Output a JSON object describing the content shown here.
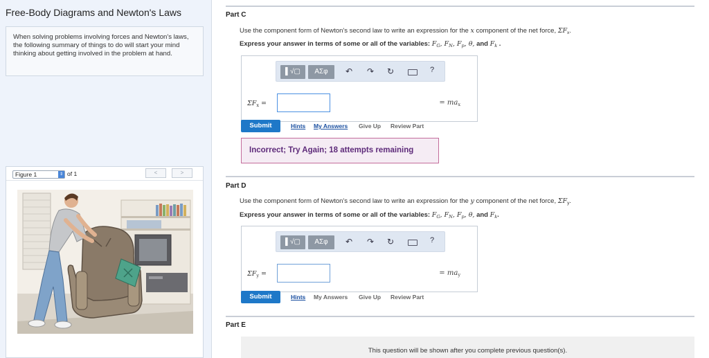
{
  "left": {
    "title": "Free-Body Diagrams and Newton's Laws",
    "intro": "When solving problems involving forces and Newton's laws, the following summary of things to do will start your mind thinking about getting involved in the problem at hand.",
    "figure": {
      "selected": "Figure 1",
      "of_label": "of 1",
      "prev": "<",
      "next": ">"
    }
  },
  "partC": {
    "label": "Part C",
    "question_pre": "Use the component form of Newton's second law to write an expression for the",
    "question_var": "x",
    "question_post": "component of the net force,",
    "sum_symbol": "ΣF",
    "sum_sub": "x",
    "instruction": "Express your answer in terms of some or all of the variables:",
    "variables": "F_G, F_N, F_p, θ, and F_k",
    "lhs": "ΣF",
    "lhs_sub": "x",
    "equals": "=",
    "rhs": "= ma",
    "rhs_sub": "x",
    "input_value": "",
    "feedback": "Incorrect; Try Again; 18 attempts remaining"
  },
  "partD": {
    "label": "Part D",
    "question_pre": "Use the component form of Newton's second law to write an expression for the",
    "question_var": "y",
    "question_post": "component of the net force,",
    "sum_symbol": "ΣF",
    "sum_sub": "y",
    "instruction": "Express your answer in terms of some or all of the variables:",
    "variables": "F_G, F_N, F_p, θ, and F_k",
    "lhs": "ΣF",
    "lhs_sub": "y",
    "equals": "=",
    "rhs": "= ma",
    "rhs_sub": "y",
    "input_value": ""
  },
  "partE": {
    "label": "Part E",
    "note": "This question will be shown after you complete previous question(s)."
  },
  "toolbar": {
    "template_btn": "▌√▢",
    "greek_btn": "ΑΣφ",
    "undo": "↶",
    "redo": "↷",
    "reset": "↻",
    "help": "?"
  },
  "actions": {
    "submit": "Submit",
    "hints": "Hints",
    "my_answers": "My Answers",
    "give_up": "Give Up",
    "review_part": "Review Part"
  },
  "colors": {
    "submit_bg": "#1e78c8",
    "feedback_border": "#c36c9b",
    "feedback_text": "#5e2b7a",
    "link": "#1a4fa0"
  }
}
